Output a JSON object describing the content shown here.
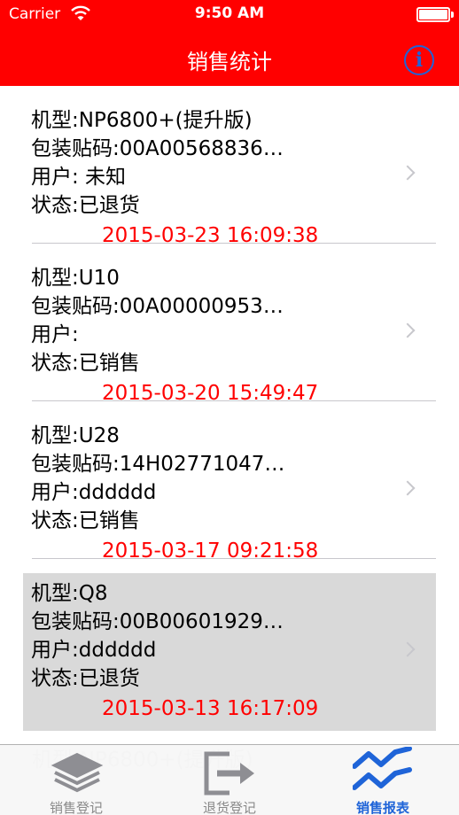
{
  "status_bar": {
    "carrier": "Carrier",
    "time": "9:50 AM",
    "wifi_icon": "wifi-icon",
    "battery_icon": "battery-icon"
  },
  "nav": {
    "title": "销售统计",
    "info_icon_glyph": "i",
    "info_icon": "info-icon"
  },
  "records": [
    {
      "model": "机型:NP6800+(提升版)",
      "code": "包装贴码:00A00568836…",
      "user": "用户: 未知",
      "state": "状态:已退货",
      "date": "2015-03-23 16:09:38"
    },
    {
      "model": "机型:U10",
      "code": "包装贴码:00A00000953…",
      "user": "用户:",
      "state": "状态:已销售",
      "date": "2015-03-20 15:49:47"
    },
    {
      "model": "机型:U28",
      "code": "包装贴码:14H02771047…",
      "user": "用户:dddddd",
      "state": "状态:已销售",
      "date": "2015-03-17 09:21:58"
    },
    {
      "model": "机型:Q8",
      "code": "包装贴码:00B00601929…",
      "user": "用户:dddddd",
      "state": "状态:已退货",
      "date": "2015-03-13 16:17:09"
    }
  ],
  "tabs": [
    {
      "label": "销售登记",
      "icon": "layers-icon"
    },
    {
      "label": "退货登记",
      "icon": "logout-icon"
    },
    {
      "label": "销售报表",
      "icon": "trend-chart-icon"
    }
  ],
  "colors": {
    "brand_red": "#ff0000",
    "accent_blue": "#1f64d8",
    "selected_row": "#d9d9d9"
  }
}
